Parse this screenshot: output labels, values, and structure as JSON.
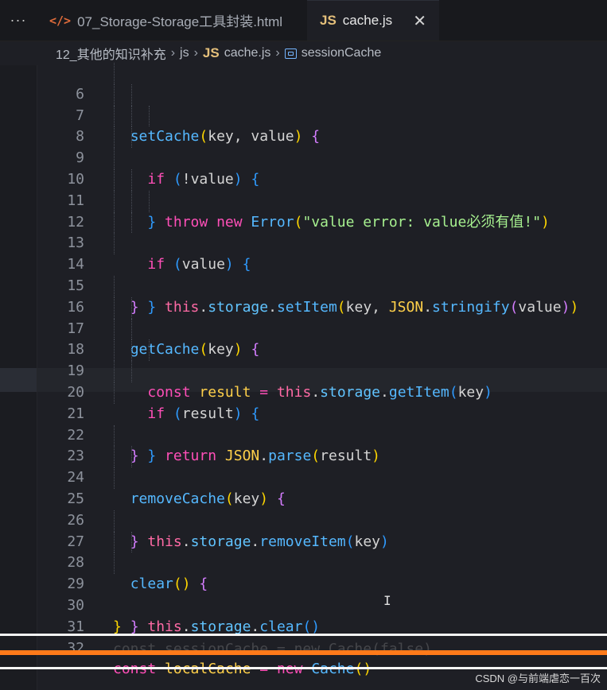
{
  "tabs": [
    {
      "label": "07_Storage-Storage工具封装.html",
      "icon": "html-icon",
      "active": false
    },
    {
      "label": "cache.js",
      "icon": "js-icon",
      "active": true,
      "close": "✕"
    }
  ],
  "more_label": "···",
  "breadcrumb": {
    "folder": "12_其他的知识补充",
    "subfolder": "js",
    "file": "cache.js",
    "symbol": "sessionCache",
    "sep": "›"
  },
  "line_numbers": [
    "6",
    "7",
    "8",
    "9",
    "10",
    "11",
    "12",
    "13",
    "14",
    "15",
    "16",
    "17",
    "18",
    "19",
    "20",
    "21",
    "22",
    "23",
    "24",
    "25",
    "26",
    "27",
    "28",
    "29",
    "30",
    "31",
    "32"
  ],
  "code_lines": [
    "setCache(key, value) {",
    "if (!value) {",
    "throw new Error(\"value error: value必须有值!\")",
    "}",
    "",
    "if (value) {",
    "this.storage.setItem(key, JSON.stringify(value))",
    "}",
    "}",
    "",
    "getCache(key) {",
    "const result = this.storage.getItem(key)",
    "if (result) {",
    "return JSON.parse(result)",
    "}",
    "}",
    "",
    "removeCache(key) {",
    "this.storage.removeItem(key)",
    "}",
    "",
    "clear() {",
    "this.storage.clear()",
    "}",
    "}",
    "",
    "const localCache = new Cache()"
  ],
  "dim_line": "const sessionCache = new Cache(false)",
  "watermark": "CSDN @与前端虐恋一百次",
  "colors": {
    "keyword": "#ff4fb8",
    "function": "#55b8ff",
    "string": "#a6f08f",
    "class": "#ffd04a",
    "accent_bar": "#ff7a1a"
  }
}
